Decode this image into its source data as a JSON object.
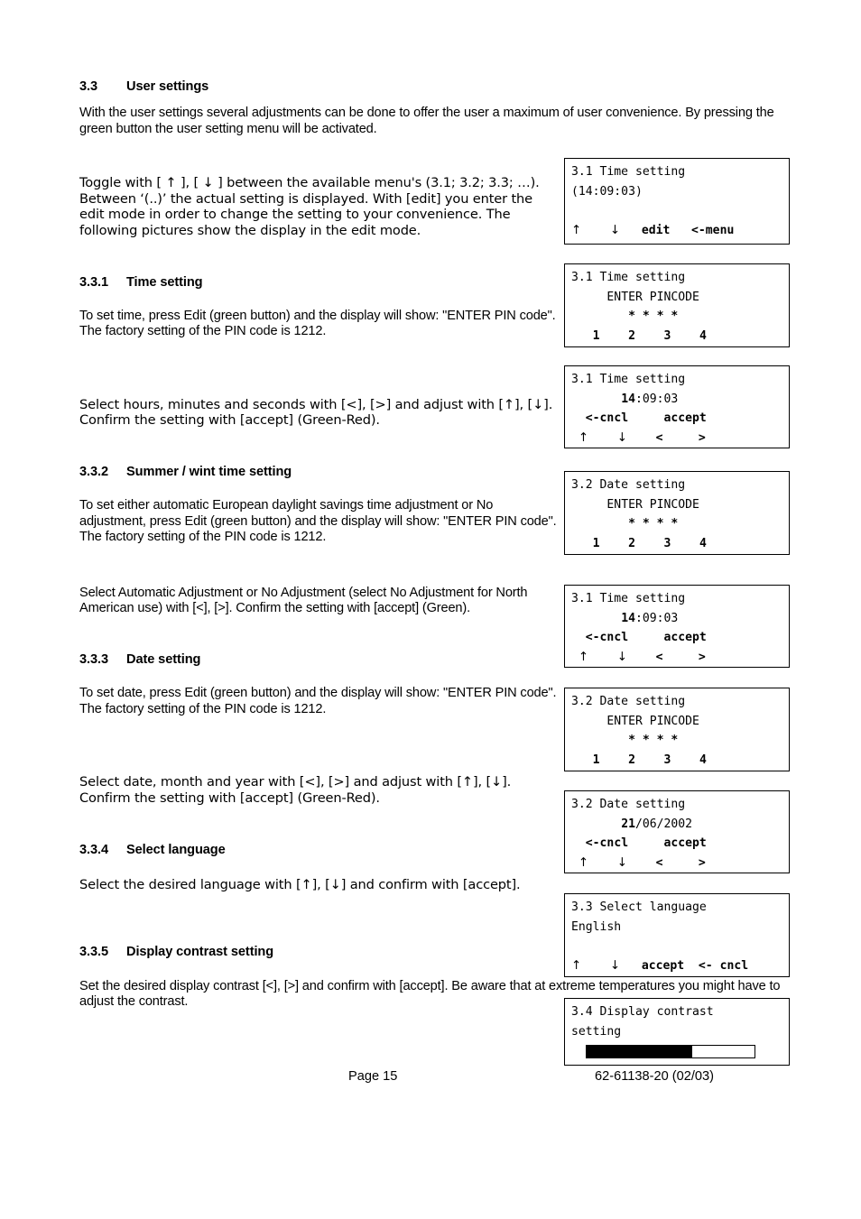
{
  "document": {
    "section_number": "3.3",
    "section_title": "User settings",
    "intro": "With the user settings several adjustments can be done to offer the user a maximum of user convenience. By pressing the green button the user setting menu will be activated.",
    "toggle_paragraph": "Toggle with  [ ↑ ],  [ ↓ ]  between the available menu's (3.1; 3.2; 3.3; …). Between ‘(..)’ the actual setting is displayed. With [edit] you enter the edit mode in order to change the setting to your convenience. The following pictures show the display in the edit mode."
  },
  "sections": [
    {
      "number": "3.3.1",
      "title": "Time setting",
      "para1": "To set time, press Edit (green button) and the display will show: \"ENTER PIN code\". The factory setting of the PIN code is  1212.",
      "para2": "Select hours, minutes and seconds with [<], [>] and adjust with [↑], [↓]. Confirm the setting with [accept] (Green-Red)."
    },
    {
      "number": "3.3.2",
      "title": "Summer / wint time setting",
      "para1": "To set either automatic European daylight savings time adjustment or No adjustment, press Edit (green button) and the display will show: \"ENTER PIN code\". The factory setting of the PIN code is  1212.",
      "para2": "Select Automatic Adjustment or No Adjustment (select No Adjustment for North American use) with [<], [>].  Confirm the setting with [accept] (Green)."
    },
    {
      "number": "3.3.3",
      "title": "Date setting",
      "para1": "To set date, press Edit (green button) and the display will show: \"ENTER PIN code\". The factory setting of the PIN code is  1212.",
      "para2": "Select date, month and year with [<], [>] and adjust with [↑], [↓]. Confirm the setting with [accept] (Green-Red)."
    },
    {
      "number": "3.3.4",
      "title": "Select language",
      "para1": "Select the desired language with [↑], [↓] and confirm with [accept]."
    },
    {
      "number": "3.3.5",
      "title": "Display contrast setting",
      "para1": "Set the desired display contrast [<], [>] and confirm with [accept]. Be aware that at extreme temperatures you might have to adjust the contrast."
    }
  ],
  "panels": {
    "p1": {
      "line1": "3.1 Time setting",
      "line2": "(14:09:03)",
      "line3": "",
      "btn_up": "↑",
      "btn_down": "↓",
      "btn_edit": "edit",
      "btn_menu": "<-menu"
    },
    "p2": {
      "line1": "3.1 Time setting",
      "line2": "ENTER PINCODE",
      "line3": "* * * *",
      "k1": "1",
      "k2": "2",
      "k3": "3",
      "k4": "4"
    },
    "p3": {
      "line1": "3.1 Time setting",
      "value_bold": "14",
      "value_rest": ":09:03",
      "btn_cncl": "<-cncl",
      "btn_accept": "accept",
      "btn_up": "↑",
      "btn_down": "↓",
      "btn_left": "<",
      "btn_right": ">"
    },
    "p4": {
      "line1": "3.2 Date setting",
      "line2": "ENTER PINCODE",
      "line3": "* * * *",
      "k1": "1",
      "k2": "2",
      "k3": "3",
      "k4": "4"
    },
    "p5": {
      "line1": "3.1 Time setting",
      "value_bold": "14",
      "value_rest": ":09:03",
      "btn_cncl": "<-cncl",
      "btn_accept": "accept",
      "btn_up": "↑",
      "btn_down": "↓",
      "btn_left": "<",
      "btn_right": ">"
    },
    "p6": {
      "line1": "3.2 Date setting",
      "line2": "ENTER PINCODE",
      "line3": "* * * *",
      "k1": "1",
      "k2": "2",
      "k3": "3",
      "k4": "4"
    },
    "p7": {
      "line1": "3.2 Date setting",
      "value_bold": "21",
      "value_rest": "/06/2002",
      "btn_cncl": "<-cncl",
      "btn_accept": "accept",
      "btn_up": "↑",
      "btn_down": "↓",
      "btn_left": "<",
      "btn_right": ">"
    },
    "p8": {
      "line1": "3.3 Select language",
      "line2": "English",
      "btn_up": "↑",
      "btn_down": "↓",
      "btn_accept": "accept",
      "btn_cncl": "<- cncl"
    },
    "p9": {
      "line1": "3.4 Display contrast",
      "line2": "setting",
      "contrast_percent": 63
    }
  },
  "footer": {
    "page_label": "Page  15",
    "doc_number": "62-61138-20   (02/03)"
  }
}
